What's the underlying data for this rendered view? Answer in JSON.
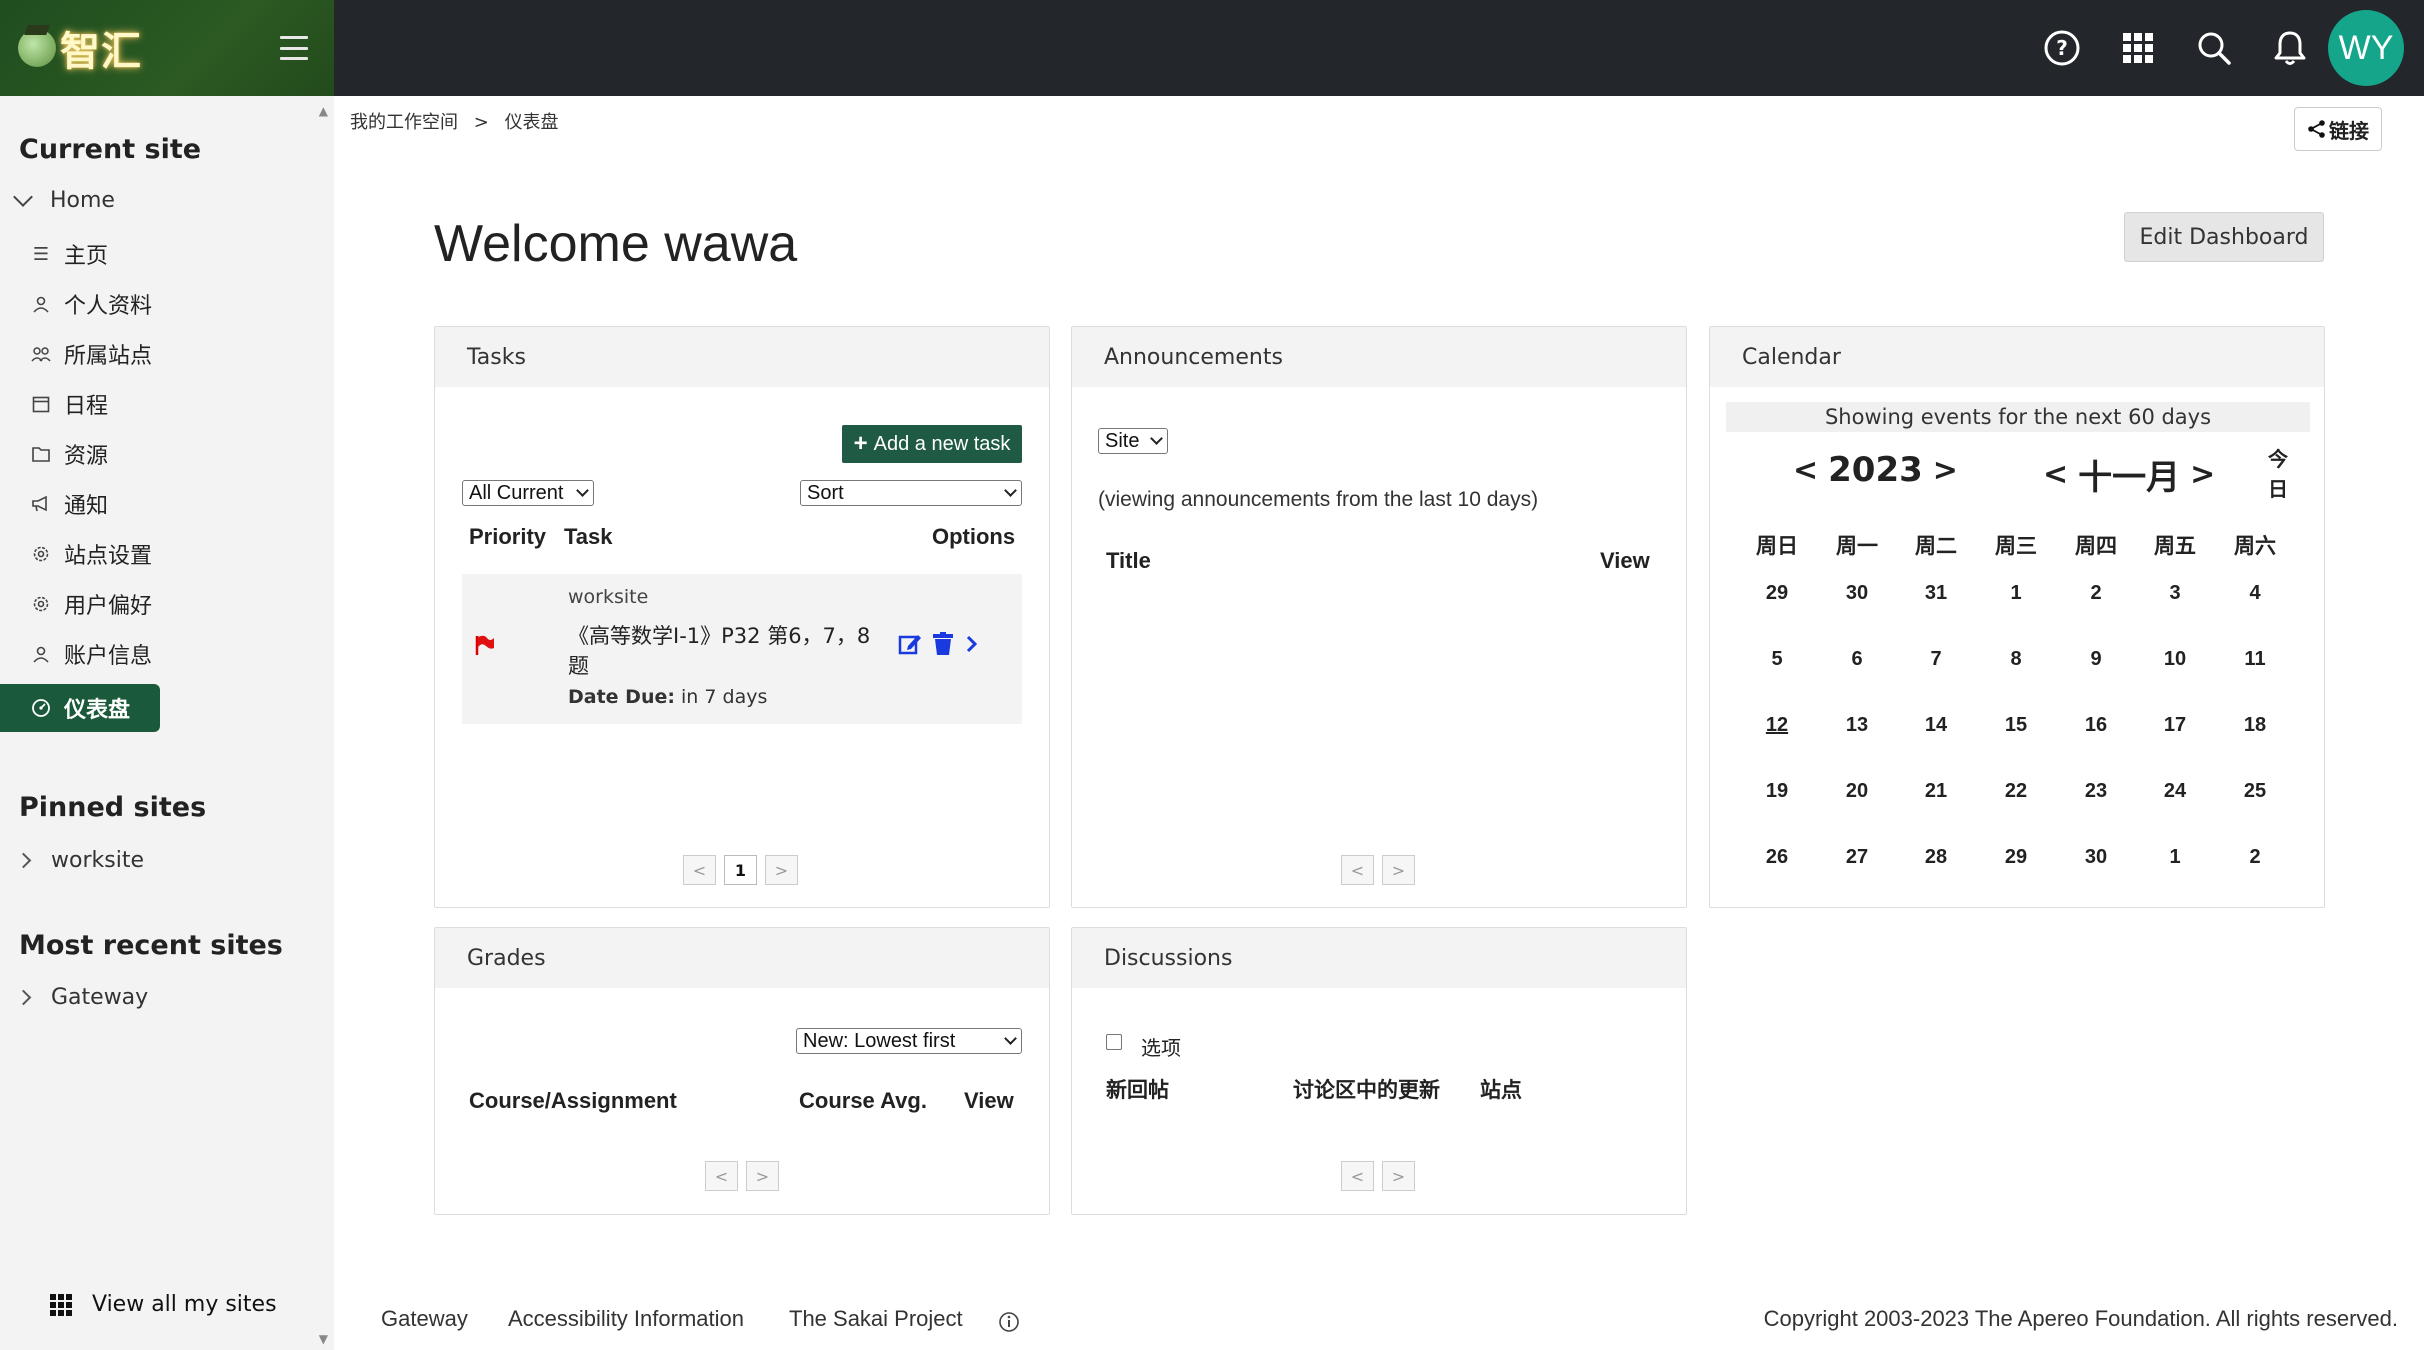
{
  "brand": {
    "logo_text": "智汇",
    "avatar_initials": "WY"
  },
  "topbar": {
    "icons": [
      "help-icon",
      "apps-grid-icon",
      "search-icon",
      "bell-icon"
    ]
  },
  "sidebar": {
    "current_site_heading": "Current site",
    "home_label": "Home",
    "items": [
      {
        "label": "主页",
        "icon": "list-icon"
      },
      {
        "label": "个人资料",
        "icon": "user-icon"
      },
      {
        "label": "所属站点",
        "icon": "users-icon"
      },
      {
        "label": "日程",
        "icon": "calendar-icon"
      },
      {
        "label": "资源",
        "icon": "folder-icon"
      },
      {
        "label": "通知",
        "icon": "megaphone-icon"
      },
      {
        "label": "站点设置",
        "icon": "gear-icon"
      },
      {
        "label": "用户偏好",
        "icon": "gear-icon"
      },
      {
        "label": "账户信息",
        "icon": "user-icon"
      },
      {
        "label": "仪表盘",
        "icon": "dashboard-icon",
        "active": true
      }
    ],
    "pinned_heading": "Pinned sites",
    "pinned": [
      "worksite"
    ],
    "recent_heading": "Most recent sites",
    "recent": [
      "Gateway"
    ],
    "view_all": "View all my sites"
  },
  "breadcrumb": [
    "我的工作空间",
    ">",
    "仪表盘"
  ],
  "link_button": "链接",
  "page_title": "Welcome wawa",
  "edit_dashboard": "Edit Dashboard",
  "tasks": {
    "title": "Tasks",
    "add_button": "Add a new task",
    "filter_value": "All Current",
    "sort_value": "Sort",
    "col_priority": "Priority",
    "col_task": "Task",
    "col_options": "Options",
    "task_site": "worksite",
    "task_line1": "《高等数学Ⅰ-1》P32 第6，7，8",
    "task_line2": "题",
    "due_label": "Date Due:",
    "due_value": "in 7 days",
    "page": "1"
  },
  "announcements": {
    "title": "Announcements",
    "scope_value": "Site",
    "viewing_text": "(viewing announcements from the last 10 days)",
    "col_title": "Title",
    "col_view": "View"
  },
  "calendar": {
    "title": "Calendar",
    "showing_text": "Showing events for the next 60 days",
    "year": "2023",
    "month": "十一月",
    "today_line1": "今",
    "today_line2": "日",
    "dow": [
      "周日",
      "周一",
      "周二",
      "周三",
      "周四",
      "周五",
      "周六"
    ],
    "weeks": [
      [
        "29",
        "30",
        "31",
        "1",
        "2",
        "3",
        "4"
      ],
      [
        "5",
        "6",
        "7",
        "8",
        "9",
        "10",
        "11"
      ],
      [
        "12",
        "13",
        "14",
        "15",
        "16",
        "17",
        "18"
      ],
      [
        "19",
        "20",
        "21",
        "22",
        "23",
        "24",
        "25"
      ],
      [
        "26",
        "27",
        "28",
        "29",
        "30",
        "1",
        "2"
      ]
    ],
    "today": "12"
  },
  "grades": {
    "title": "Grades",
    "sort_value": "New: Lowest first",
    "col_course": "Course/Assignment",
    "col_avg": "Course Avg.",
    "col_view": "View"
  },
  "discussions": {
    "title": "Discussions",
    "option_label": "选项",
    "col_new": "新回帖",
    "col_updates": "讨论区中的更新",
    "col_site": "站点"
  },
  "footer": {
    "links": [
      "Gateway",
      "Accessibility Information",
      "The Sakai Project"
    ],
    "copyright": "Copyright 2003-2023 The Apereo Foundation. All rights reserved."
  },
  "colors": {
    "brand_green": "#1f4d1f",
    "active_green": "#1a5a3a",
    "avatar": "#14a58a",
    "topbar": "#23272b"
  }
}
